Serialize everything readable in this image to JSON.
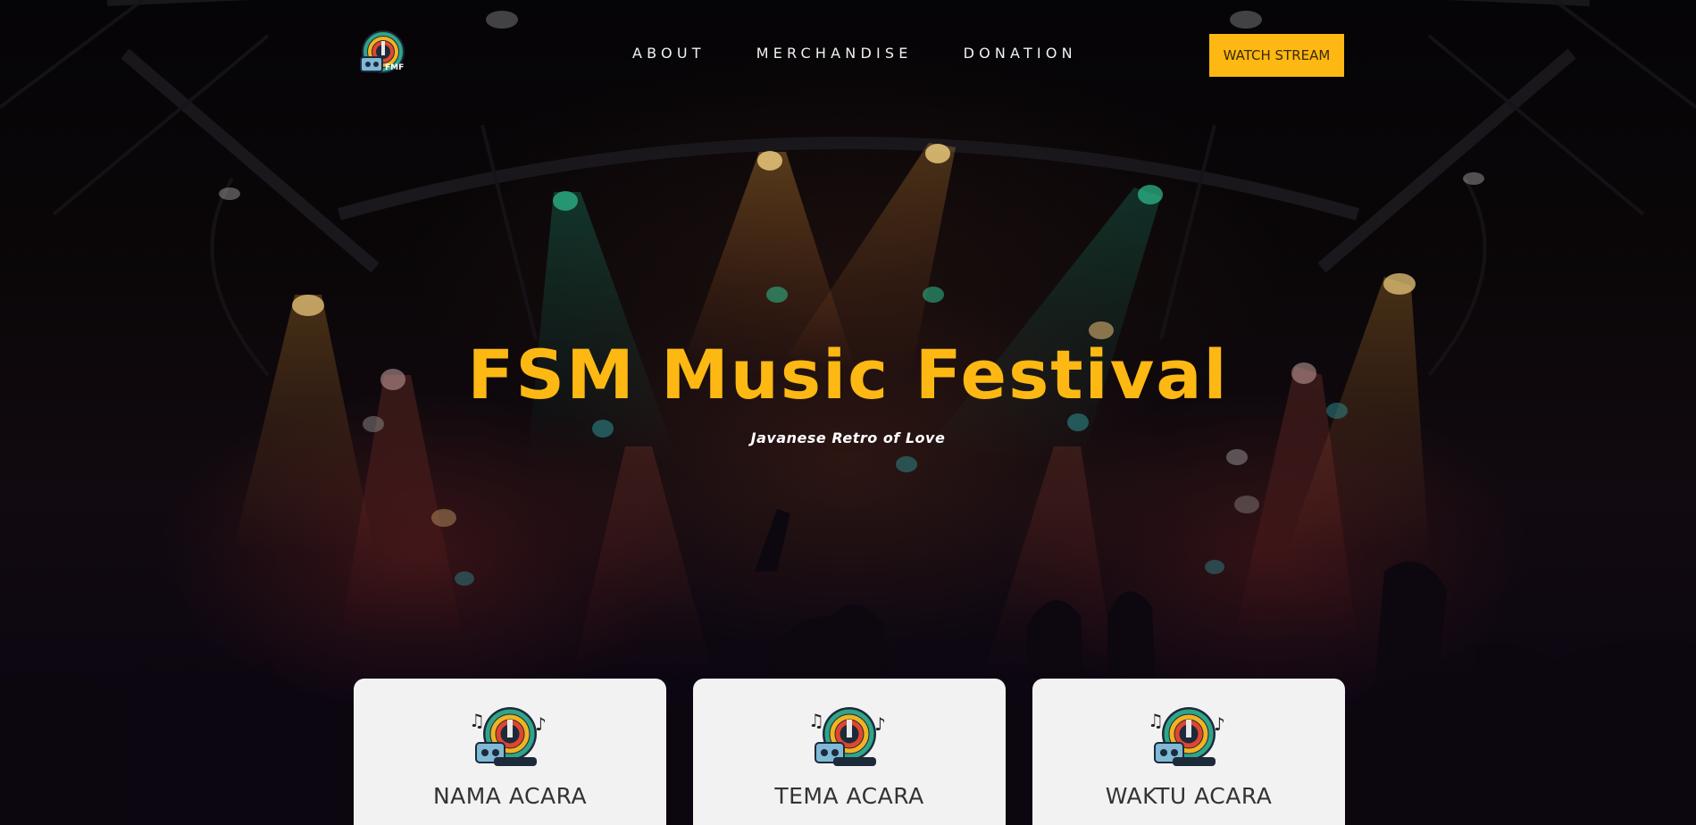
{
  "nav": {
    "logo": {
      "icon": "fmf-festival-logo",
      "text": "FMF"
    },
    "links": [
      {
        "label": "ABOUT"
      },
      {
        "label": "MERCHANDISE"
      },
      {
        "label": "DONATION"
      }
    ],
    "cta_label": "WATCH STREAM"
  },
  "hero": {
    "title": "FSM Music Festival",
    "subtitle": "Javanese Retro of Love",
    "background": "concert-stage-lights-crowd"
  },
  "cards": [
    {
      "title": "NAMA ACARA",
      "icon": "fmf-festival-logo"
    },
    {
      "title": "TEMA ACARA",
      "icon": "fmf-festival-logo"
    },
    {
      "title": "WAKTU ACARA",
      "icon": "fmf-festival-logo"
    }
  ],
  "colors": {
    "accent": "#fdb813",
    "card_bg": "#f2f2f2",
    "nav_text": "#f2f2f2",
    "background": "#07040a"
  }
}
